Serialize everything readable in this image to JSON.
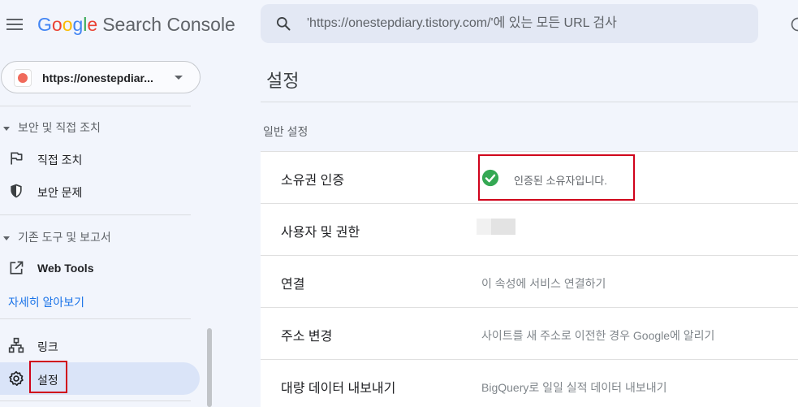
{
  "header": {
    "logo_google": "Google",
    "logo_product": "Search Console",
    "search_placeholder": "'https://onestepdiary.tistory.com/'에 있는 모든 URL 검사"
  },
  "sidebar": {
    "property_label": "https://onestepdiar...",
    "section_security": "보안 및 직접 조치",
    "item_manual_actions": "직접 조치",
    "item_security_issues": "보안 문제",
    "section_legacy": "기존 도구 및 보고서",
    "item_web_tools": "Web Tools",
    "learn_more": "자세히 알아보기",
    "item_links": "링크",
    "item_settings": "설정"
  },
  "main": {
    "page_title": "설정",
    "section_title": "일반 설정",
    "rows": [
      {
        "label": "소유권 인증",
        "value": "인증된 소유자입니다."
      },
      {
        "label": "사용자 및 권한",
        "value": ""
      },
      {
        "label": "연결",
        "value": "이 속성에 서비스 연결하기"
      },
      {
        "label": "주소 변경",
        "value": "사이트를 새 주소로 이전한 경우 Google에 알리기"
      },
      {
        "label": "대량 데이터 내보내기",
        "value": "BigQuery로 일일 실적 데이터 내보내기"
      }
    ]
  },
  "colors": {
    "accent": "#1a73e8",
    "verified_green": "#34a853",
    "highlight_red": "#d0021b",
    "active_nav_bg": "#dae4f8"
  },
  "icons": [
    "menu-icon",
    "search-icon",
    "help-icon",
    "flag-icon",
    "shield-icon",
    "external-link-icon",
    "sitemap-icon",
    "gear-icon",
    "check-circle-icon",
    "dropdown-caret-icon"
  ]
}
